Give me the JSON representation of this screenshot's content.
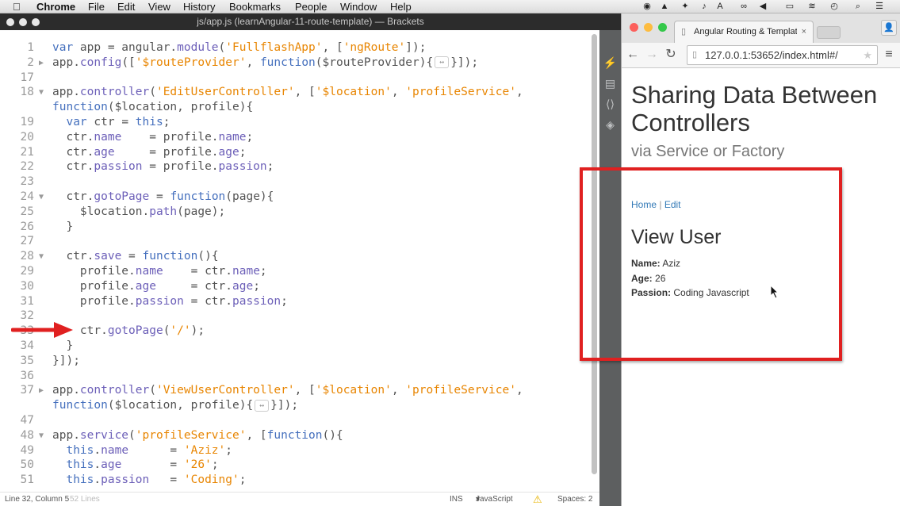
{
  "menubar": {
    "app_name": "Chrome",
    "items": [
      "File",
      "Edit",
      "View",
      "History",
      "Bookmarks",
      "People",
      "Window",
      "Help"
    ]
  },
  "brackets": {
    "title": "js/app.js (learnAngular-11-route-template) — Brackets",
    "code_lines": [
      {
        "num": "1",
        "fold": "",
        "html": "<span class=\"kw\">var</span> app = angular.<span class=\"pr\">module</span>(<span class=\"st\">'FullflashApp'</span>, [<span class=\"st\">'ngRoute'</span>]);"
      },
      {
        "num": "2",
        "fold": "▶",
        "html": "app.<span class=\"pr\">config</span>([<span class=\"st\">'$routeProvider'</span>, <span class=\"kw\">function</span>($routeProvider){<span class=\"collapsed\">↔</span>}]);"
      },
      {
        "num": "17",
        "fold": "",
        "html": ""
      },
      {
        "num": "18",
        "fold": "▼",
        "html": "app.<span class=\"pr\">controller</span>(<span class=\"st\">'EditUserController'</span>, [<span class=\"st\">'$location'</span>, <span class=\"st\">'profileService'</span>,"
      },
      {
        "num": "",
        "fold": "",
        "html": "<span class=\"kw\">function</span>($location, profile){"
      },
      {
        "num": "19",
        "fold": "",
        "html": "  <span class=\"kw\">var</span> ctr = <span class=\"kw\">this</span>;"
      },
      {
        "num": "20",
        "fold": "",
        "html": "  ctr.<span class=\"pr\">name</span>    = profile.<span class=\"pr\">name</span>;"
      },
      {
        "num": "21",
        "fold": "",
        "html": "  ctr.<span class=\"pr\">age</span>     = profile.<span class=\"pr\">age</span>;"
      },
      {
        "num": "22",
        "fold": "",
        "html": "  ctr.<span class=\"pr\">passion</span> = profile.<span class=\"pr\">passion</span>;"
      },
      {
        "num": "23",
        "fold": "",
        "html": ""
      },
      {
        "num": "24",
        "fold": "▼",
        "html": "  ctr.<span class=\"pr\">gotoPage</span> = <span class=\"kw\">function</span>(page){"
      },
      {
        "num": "25",
        "fold": "",
        "html": "    $location.<span class=\"pr\">path</span>(page);"
      },
      {
        "num": "26",
        "fold": "",
        "html": "  }"
      },
      {
        "num": "27",
        "fold": "",
        "html": ""
      },
      {
        "num": "28",
        "fold": "▼",
        "html": "  ctr.<span class=\"pr\">save</span> = <span class=\"kw\">function</span>(){"
      },
      {
        "num": "29",
        "fold": "",
        "html": "    profile.<span class=\"pr\">name</span>    = ctr.<span class=\"pr\">name</span>;"
      },
      {
        "num": "30",
        "fold": "",
        "html": "    profile.<span class=\"pr\">age</span>     = ctr.<span class=\"pr\">age</span>;"
      },
      {
        "num": "31",
        "fold": "",
        "html": "    profile.<span class=\"pr\">passion</span> = ctr.<span class=\"pr\">passion</span>;"
      },
      {
        "num": "32",
        "fold": "",
        "html": ""
      },
      {
        "num": "33",
        "fold": "",
        "html": "    ctr.<span class=\"pr\">gotoPage</span>(<span class=\"st\">'/'</span>);"
      },
      {
        "num": "34",
        "fold": "",
        "html": "  }"
      },
      {
        "num": "35",
        "fold": "",
        "html": "}]);"
      },
      {
        "num": "36",
        "fold": "",
        "html": ""
      },
      {
        "num": "37",
        "fold": "▶",
        "html": "app.<span class=\"pr\">controller</span>(<span class=\"st\">'ViewUserController'</span>, [<span class=\"st\">'$location'</span>, <span class=\"st\">'profileService'</span>,"
      },
      {
        "num": "",
        "fold": "",
        "html": "<span class=\"kw\">function</span>($location, profile){<span class=\"collapsed\">↔</span>}]);"
      },
      {
        "num": "47",
        "fold": "",
        "html": ""
      },
      {
        "num": "48",
        "fold": "▼",
        "html": "app.<span class=\"pr\">service</span>(<span class=\"st\">'profileService'</span>, [<span class=\"kw\">function</span>(){"
      },
      {
        "num": "49",
        "fold": "",
        "html": "  <span class=\"kw\">this</span>.<span class=\"pr\">name</span>      = <span class=\"st\">'Aziz'</span>;"
      },
      {
        "num": "50",
        "fold": "",
        "html": "  <span class=\"kw\">this</span>.<span class=\"pr\">age</span>       = <span class=\"st\">'26'</span>;"
      },
      {
        "num": "51",
        "fold": "",
        "html": "  <span class=\"kw\">this</span>.<span class=\"pr\">passion</span>   = <span class=\"st\">'Coding'</span>;"
      }
    ],
    "status": {
      "position": "Line 32, Column 5",
      "line_count": "52 Lines",
      "ins": "INS",
      "language": "JavaScript",
      "spaces": "Spaces: 2"
    }
  },
  "chrome": {
    "tab_title": "Angular Routing & Templat",
    "url": "127.0.0.1:53652/index.html#/",
    "page": {
      "title": "Sharing Data Between Controllers",
      "subtitle": "via Service or Factory",
      "nav_home": "Home",
      "nav_sep": " | ",
      "nav_edit": "Edit",
      "heading": "View User",
      "name_label": "Name:",
      "name_value": "Aziz",
      "age_label": "Age:",
      "age_value": "26",
      "passion_label": "Passion:",
      "passion_value": "Coding Javascript"
    }
  },
  "colors": {
    "annotation_red": "#e02020",
    "keyword": "#446fbd",
    "property": "#6c5fb8",
    "string": "#e88501",
    "link": "#337ab7"
  }
}
